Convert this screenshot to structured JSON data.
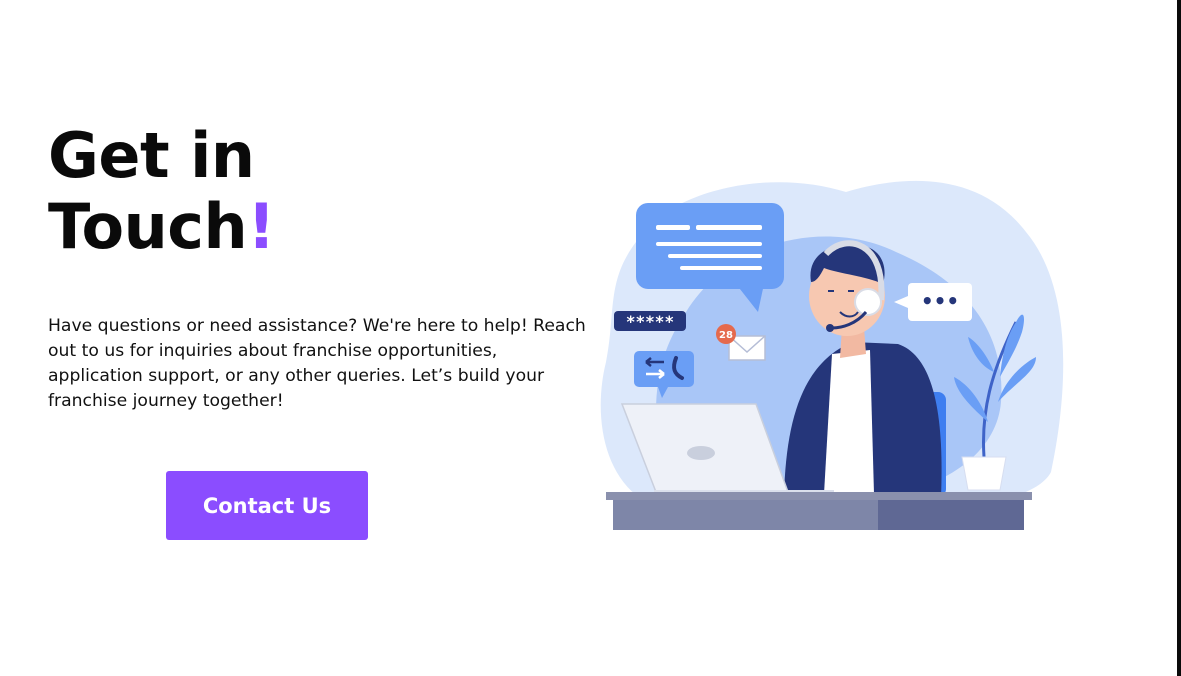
{
  "hero": {
    "title_line1": "Get in",
    "title_line2_main": "Touch",
    "title_line2_accent": "!",
    "description": "Have questions or need assistance? We're here to help! Reach out to us for inquiries about franchise opportunities, application support, or any other queries. Let’s build your franchise journey together!",
    "cta_label": "Contact Us"
  },
  "illustration": {
    "password_mask": "*****",
    "notification_badge": "28",
    "typing_indicator": "•••"
  },
  "colors": {
    "accent": "#8b4dff",
    "text": "#0a0a0a",
    "blob_light": "#dce8fb",
    "blob_mid": "#a9c6f7",
    "navy": "#25367a",
    "desk": "#8a90ad"
  },
  "icons": [
    "chat-bubble-icon",
    "password-icon",
    "mail-icon",
    "phone-transfer-icon",
    "typing-bubble-icon",
    "headset-icon",
    "laptop-icon",
    "plant-icon"
  ]
}
